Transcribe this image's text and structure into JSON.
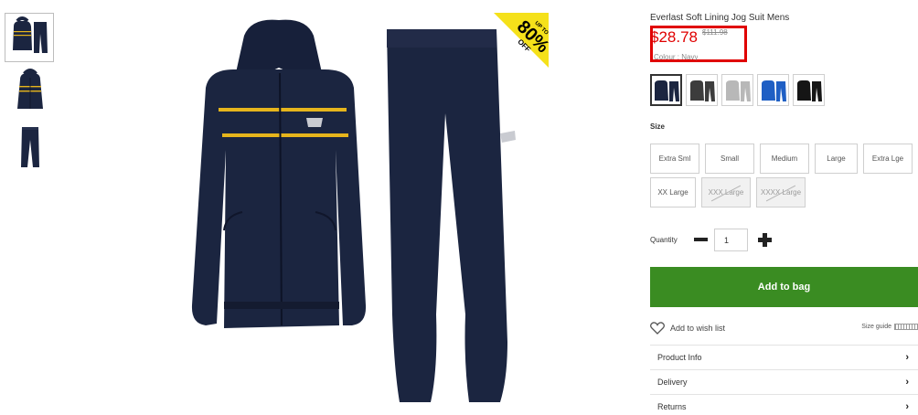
{
  "product": {
    "title": "Everlast Soft Lining Jog Suit Mens",
    "price": "$28.78",
    "was_price": "$111.98",
    "colour_label": "Colour : Navy",
    "badge": {
      "line1": "UP TO",
      "line2": "80%",
      "line3": "OFF"
    }
  },
  "thumbnails": [
    {
      "icon": "tracksuit-set-thumb"
    },
    {
      "icon": "jacket-thumb"
    },
    {
      "icon": "pants-thumb"
    }
  ],
  "swatches": [
    {
      "name": "navy",
      "color": "#1b2540",
      "selected": true
    },
    {
      "name": "charcoal",
      "color": "#3c3c3c",
      "selected": false
    },
    {
      "name": "grey",
      "color": "#b8b8b8",
      "selected": false
    },
    {
      "name": "royal-blue",
      "color": "#1f5fc4",
      "selected": false
    },
    {
      "name": "black",
      "color": "#151515",
      "selected": false
    }
  ],
  "size": {
    "label": "Size",
    "options": [
      {
        "label": "Extra Sml",
        "available": true
      },
      {
        "label": "Small",
        "available": true
      },
      {
        "label": "Medium",
        "available": true
      },
      {
        "label": "Large",
        "available": true
      },
      {
        "label": "Extra Lge",
        "available": true
      },
      {
        "label": "XX Large",
        "available": true
      },
      {
        "label": "XXX Large",
        "available": false
      },
      {
        "label": "XXXX Large",
        "available": false
      }
    ]
  },
  "quantity": {
    "label": "Quantity",
    "value": "1"
  },
  "actions": {
    "add_to_bag": "Add to bag",
    "wishlist": "Add to wish list",
    "size_guide": "Size guide"
  },
  "accordion": [
    {
      "label": "Product Info"
    },
    {
      "label": "Delivery"
    },
    {
      "label": "Returns"
    }
  ],
  "colors": {
    "price_red": "#e00000",
    "add_to_bag_green": "#3a8c22",
    "badge_yellow": "#f5e11a",
    "garment_navy": "#1b2540",
    "stripe_yellow": "#e6b51c"
  }
}
